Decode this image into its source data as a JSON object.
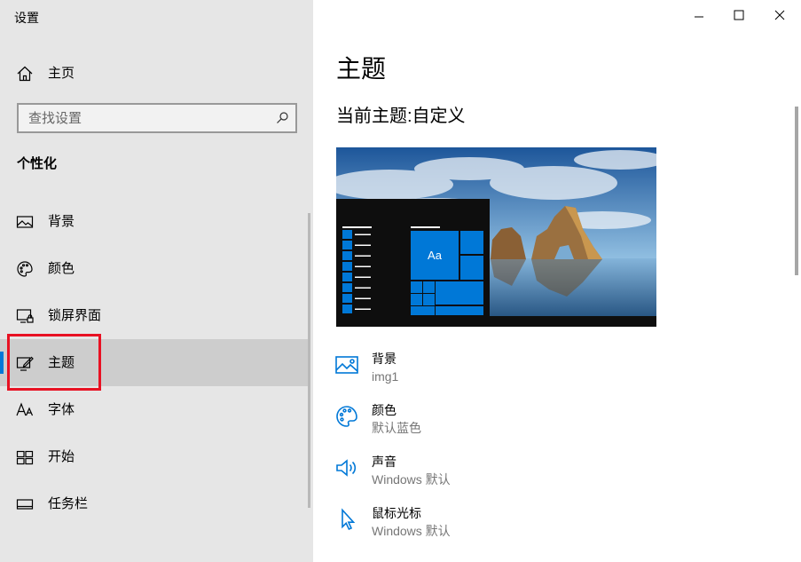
{
  "app_title": "设置",
  "window_controls": {
    "minimize_icon": "minimize-icon",
    "maximize_icon": "maximize-icon",
    "close_icon": "close-icon"
  },
  "sidebar": {
    "home": {
      "label": "主页",
      "icon": "home-icon"
    },
    "search": {
      "placeholder": "查找设置",
      "icon": "search-icon"
    },
    "section_title": "个性化",
    "items": [
      {
        "label": "背景",
        "icon": "picture-icon",
        "selected": false
      },
      {
        "label": "颜色",
        "icon": "palette-icon",
        "selected": false
      },
      {
        "label": "锁屏界面",
        "icon": "lock-screen-icon",
        "selected": false
      },
      {
        "label": "主题",
        "icon": "theme-icon",
        "selected": true
      },
      {
        "label": "字体",
        "icon": "font-icon",
        "selected": false
      },
      {
        "label": "开始",
        "icon": "start-icon",
        "selected": false
      },
      {
        "label": "任务栏",
        "icon": "taskbar-icon",
        "selected": false
      }
    ]
  },
  "main": {
    "page_title": "主题",
    "current_theme": "当前主题:自定义",
    "preview": {
      "tile_text": "Aa"
    },
    "settings_items": [
      {
        "title": "背景",
        "value": "img1",
        "icon": "picture-icon"
      },
      {
        "title": "颜色",
        "value": "默认蓝色",
        "icon": "palette-icon"
      },
      {
        "title": "声音",
        "value": "Windows 默认",
        "icon": "speaker-icon"
      },
      {
        "title": "鼠标光标",
        "value": "Windows 默认",
        "icon": "cursor-icon"
      }
    ]
  },
  "colors": {
    "accent": "#0078d7",
    "sidebar_bg": "#e6e6e6",
    "selected_bg": "#cdcdcd",
    "highlight_box": "#e81123",
    "secondary_text": "#767676"
  }
}
